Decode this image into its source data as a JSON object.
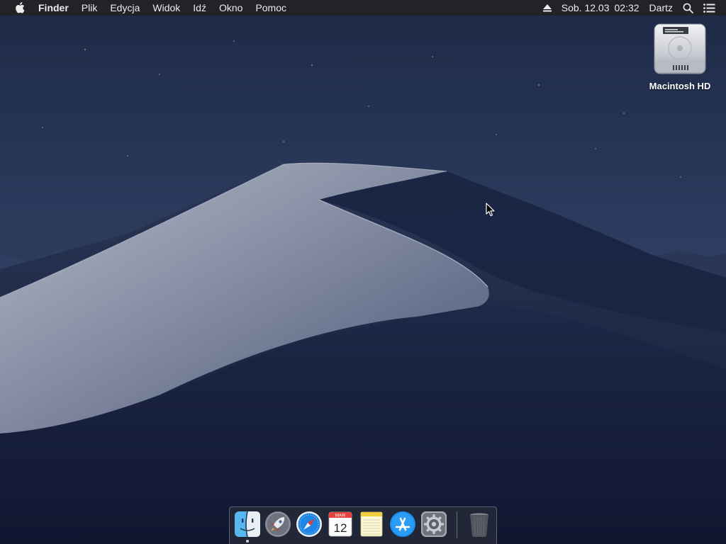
{
  "menubar": {
    "app_name": "Finder",
    "menus": [
      "Plik",
      "Edycja",
      "Widok",
      "Idź",
      "Okno",
      "Pomoc"
    ],
    "date": "Sob. 12.03",
    "time": "02:32",
    "user": "Dartz",
    "icons": {
      "apple": "apple-logo-icon",
      "eject": "eject-icon",
      "search": "spotlight-search-icon",
      "notifications": "notification-center-icon"
    }
  },
  "desktop": {
    "drive_label": "Macintosh HD",
    "drive_icon": "hard-drive-icon",
    "wallpaper": "mojave-night-dunes"
  },
  "dock": {
    "apps": [
      {
        "name": "Finder",
        "icon": "finder-icon",
        "running": true
      },
      {
        "name": "Launchpad",
        "icon": "launchpad-rocket-icon",
        "running": false
      },
      {
        "name": "Safari",
        "icon": "safari-compass-icon",
        "running": false
      },
      {
        "name": "Calendar",
        "icon": "calendar-icon",
        "running": false,
        "month": "MAR",
        "day": "12"
      },
      {
        "name": "Notes",
        "icon": "notes-icon",
        "running": false
      },
      {
        "name": "App Store",
        "icon": "app-store-icon",
        "running": false
      },
      {
        "name": "System Preferences",
        "icon": "gear-icon",
        "running": false
      }
    ],
    "trash": {
      "name": "Trash",
      "icon": "trash-icon"
    }
  },
  "colors": {
    "menubar_bg": "#222228",
    "menubar_text": "#ececec",
    "sky_top": "#1f2c4a",
    "sky_bottom": "#3a4d70",
    "dune_light": "#9aa2b6",
    "dune_dark": "#1b2544"
  }
}
